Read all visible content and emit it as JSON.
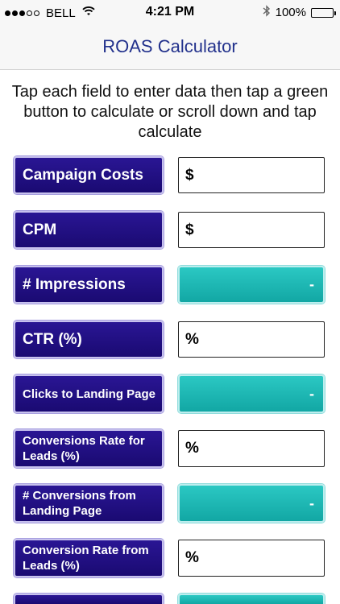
{
  "status_bar": {
    "carrier": "BELL",
    "time": "4:21 PM",
    "battery": "100%",
    "battery_level": 1.0,
    "signal_dots_filled": 3,
    "signal_dots_total": 5
  },
  "nav": {
    "title": "ROAS Calculator"
  },
  "instructions": "Tap each field to enter data then tap a green button to calculate or scroll down and tap calculate",
  "rows": [
    {
      "label": "Campaign Costs",
      "type": "input",
      "value": "$"
    },
    {
      "label": "CPM",
      "type": "input",
      "value": "$"
    },
    {
      "label": "# Impressions",
      "type": "result",
      "value": "-"
    },
    {
      "label": "CTR (%)",
      "type": "input",
      "value": "%"
    },
    {
      "label": "Clicks to Landing Page",
      "type": "result",
      "value": "-"
    },
    {
      "label": "Conversions Rate for Leads (%)",
      "type": "input",
      "value": "%"
    },
    {
      "label": "# Conversions from Landing Page",
      "type": "result",
      "value": "-"
    },
    {
      "label": "Conversion Rate from Leads (%)",
      "type": "input",
      "value": "%"
    }
  ],
  "colors": {
    "label_button": "#1f0f80",
    "result_button": "#1fb8b5",
    "nav_title": "#22318c"
  }
}
